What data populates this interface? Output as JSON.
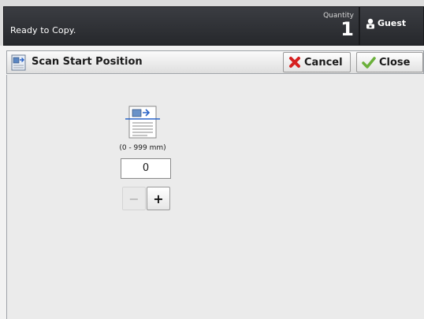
{
  "status": {
    "message": "Ready to Copy.",
    "quantity_label": "Quantity",
    "quantity_value": "1",
    "user_label": "Guest"
  },
  "titlebar": {
    "title": "Scan Start Position",
    "cancel_label": "Cancel",
    "close_label": "Close"
  },
  "main": {
    "range_text": "(0 - 999 mm)",
    "value": "0",
    "minus_label": "−",
    "plus_label": "+"
  },
  "icons": {
    "user": "person-lock-icon",
    "title": "scan-position-icon",
    "cancel": "red-x-icon",
    "close": "green-check-icon",
    "document": "document-scan-icon"
  },
  "colors": {
    "status_bg": "#2d2f33",
    "cancel_icon": "#d62020",
    "close_icon": "#6ab03a",
    "scan_line": "#2a64c8"
  }
}
